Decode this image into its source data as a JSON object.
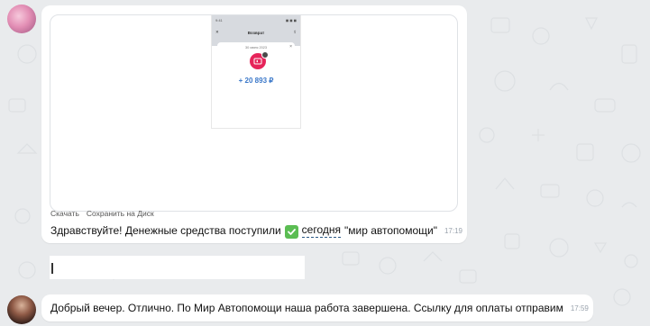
{
  "messages": {
    "first": {
      "attachment": {
        "phone": {
          "status_left": "9:41",
          "status_right": "◼ ◼ ◼",
          "header_title": "Возврат",
          "card_date": "30 июня 2023",
          "amount": "+ 20 893 ₽"
        },
        "actions": {
          "download": "Скачать",
          "save_to_disk": "Сохранить на Диск"
        }
      },
      "text_before": "Здравствуйте! Денежные средства поступили",
      "text_underlined": "сегодня",
      "text_after": "\"мир автопомощи\"",
      "time": "17:19"
    },
    "third": {
      "text": "Добрый вечер. Отлично. По Мир Автопомощи наша работа завершена. Ссылку для оплаты отправим",
      "time": "17:59"
    }
  },
  "icons": {
    "check_emoji": "check-mark-button-emoji",
    "refund": "refund-icon",
    "clock": "clock-badge-icon"
  },
  "colors": {
    "background": "#e9ebed",
    "bubble": "#ffffff",
    "refund_pink": "#e6245a",
    "amount_blue": "#3b78c9",
    "check_green": "#5bbd53"
  }
}
